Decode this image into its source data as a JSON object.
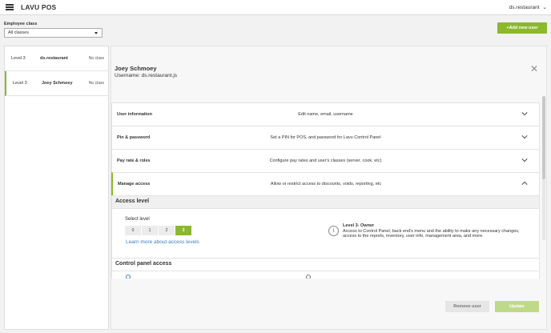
{
  "app": {
    "title": "LAVU POS",
    "account": "ds.restaurant"
  },
  "filter": {
    "label": "Employee class",
    "selected": "All classes"
  },
  "add_user_label": "+Add new user",
  "users": [
    {
      "level": "Level 3",
      "name": "ds.restaurant",
      "class": "No class"
    },
    {
      "level": "Level 3",
      "name": "Joey Schmoey",
      "class": "No class"
    }
  ],
  "detail": {
    "name": "Joey Schmoey",
    "username": "Username: ds.restaurant.js",
    "sections": [
      {
        "title": "User information",
        "desc": "Edit name, email, username"
      },
      {
        "title": "Pin & password",
        "desc": "Set a PIN for POS, and password for Lavu Control Panel"
      },
      {
        "title": "Pay rate & roles",
        "desc": "Configure pay rates and user's classes (server, cook, etc)"
      },
      {
        "title": "Manage access",
        "desc": "Allow or restrict access to discounts, voids, reporting, etc"
      }
    ],
    "access": {
      "heading": "Access level",
      "select_label": "Select level",
      "levels": [
        "0",
        "1",
        "2",
        "3"
      ],
      "selected_level": "3",
      "learn_more": "Learn more about access levels",
      "info_title": "Level 3- Owner",
      "info_text": "Access to Control Panel, back end's menu and the ability to make any necessary changes, access to the reports, inventory, user info, management area, and more."
    },
    "control_panel": {
      "heading": "Control panel access"
    },
    "remove_label": "Remove user",
    "update_label": "Update"
  },
  "colors": {
    "accent": "#8cb82d",
    "link": "#3b7fc4"
  }
}
